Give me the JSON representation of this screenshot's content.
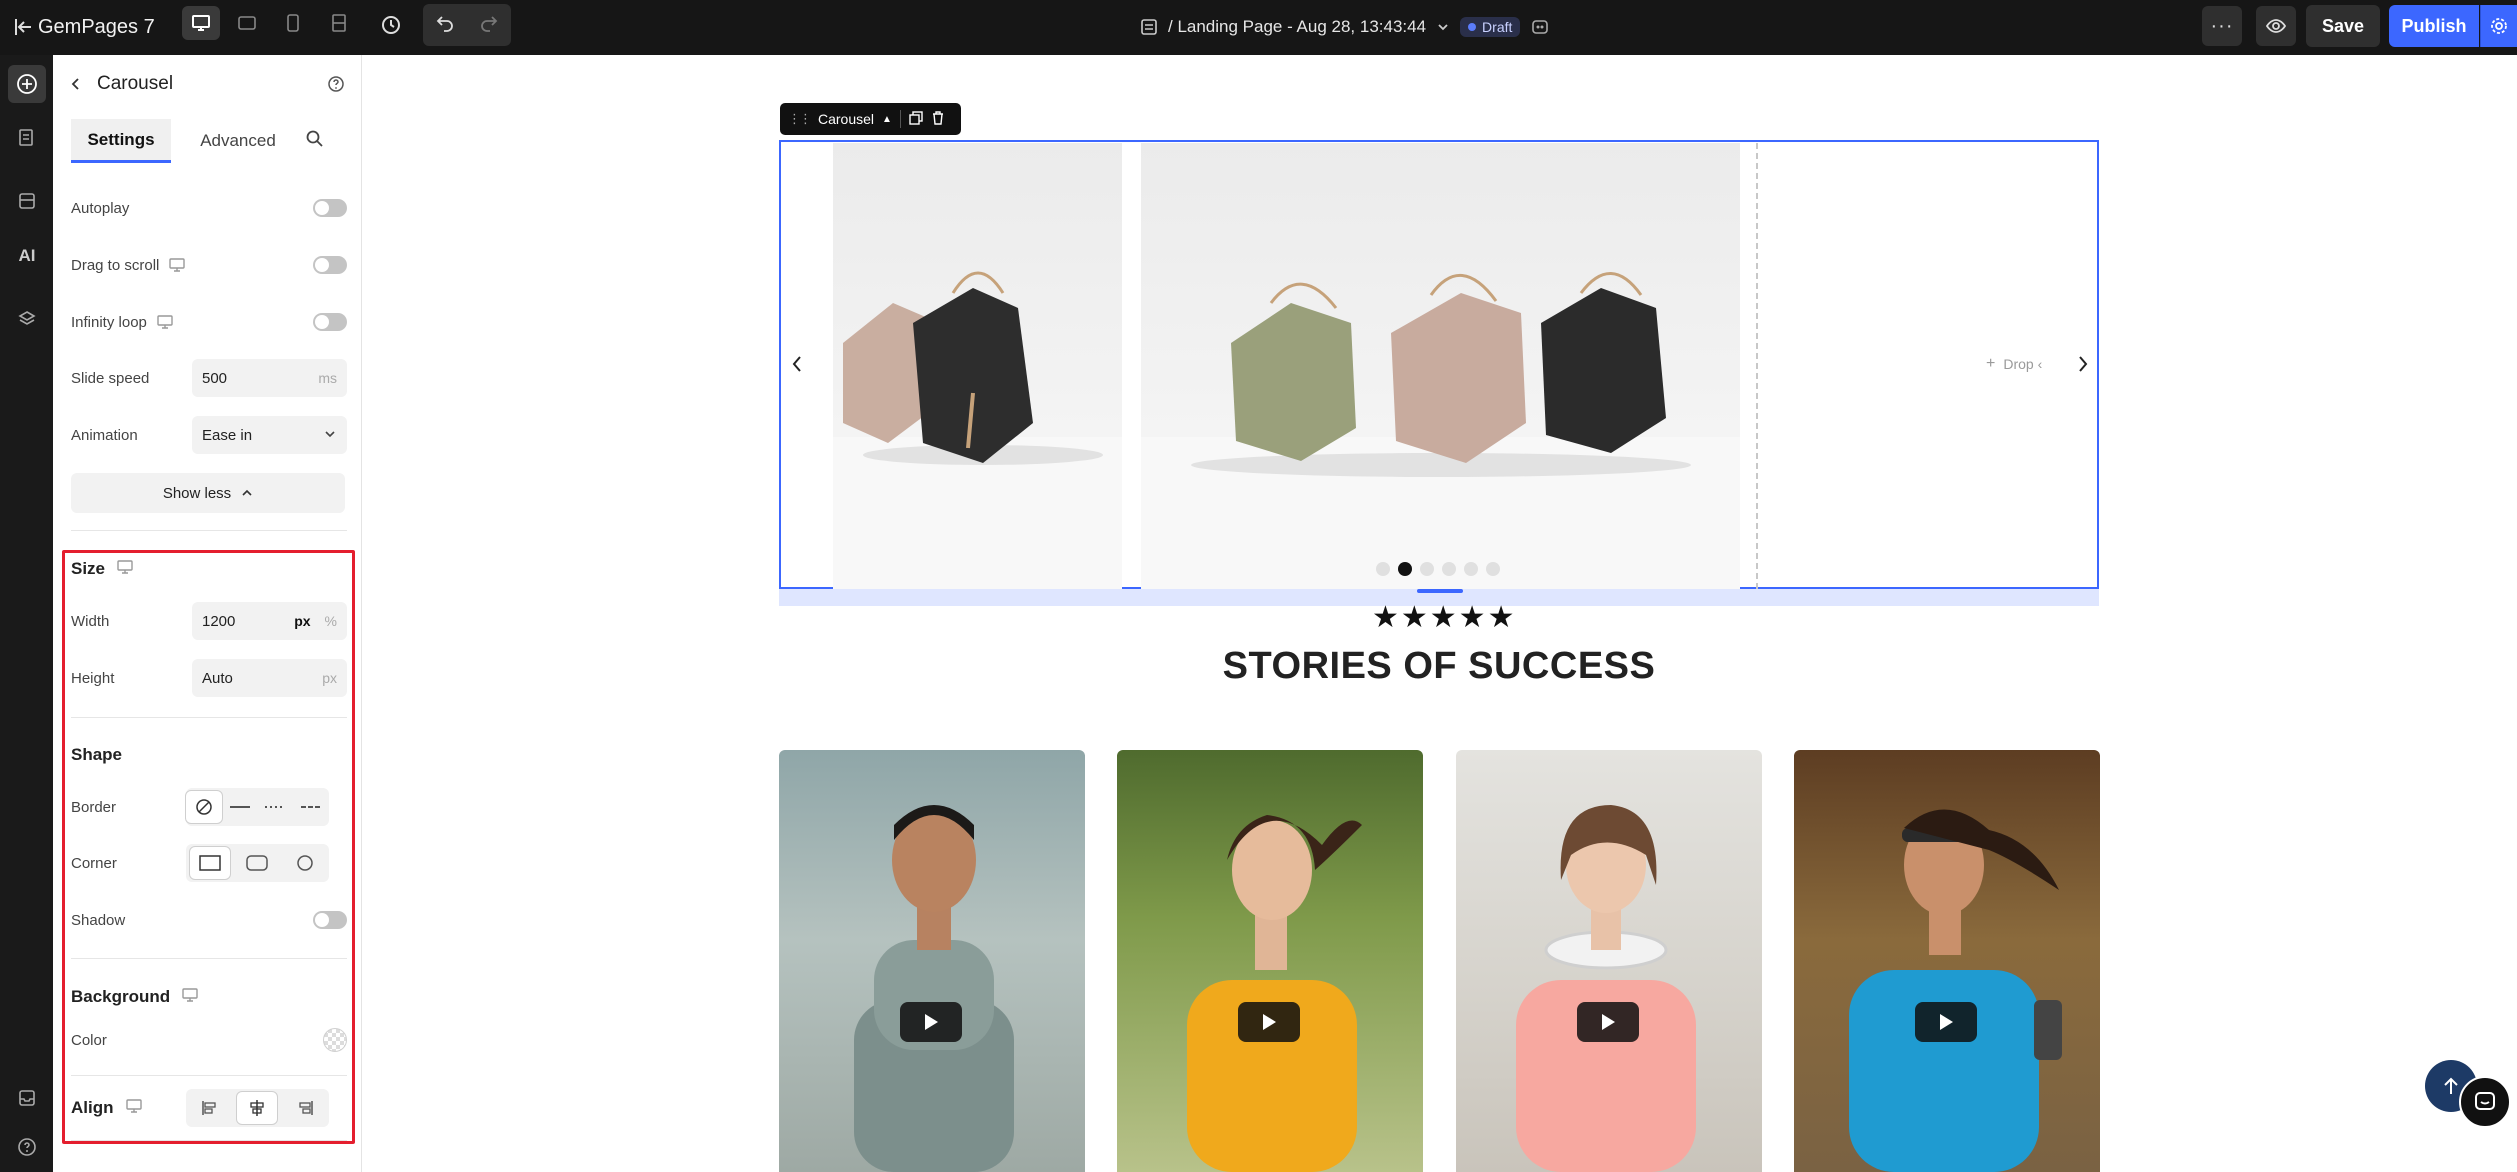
{
  "app": {
    "brand": "GemPages 7",
    "page_title": "/ Landing Page - Aug 28, 13:43:44",
    "status_badge": "Draft",
    "save_label": "Save",
    "publish_label": "Publish"
  },
  "panel": {
    "title": "Carousel",
    "tabs": [
      "Settings",
      "Advanced"
    ],
    "autoplay_label": "Autoplay",
    "drag_label": "Drag to scroll",
    "infinity_label": "Infinity loop",
    "slide_speed_label": "Slide speed",
    "slide_speed_value": "500",
    "slide_speed_unit": "ms",
    "animation_label": "Animation",
    "animation_value": "Ease in",
    "show_less_label": "Show less",
    "size": {
      "title": "Size",
      "width_label": "Width",
      "width_value": "1200",
      "width_unit_px": "px",
      "width_unit_pct": "%",
      "height_label": "Height",
      "height_value": "Auto",
      "height_unit": "px"
    },
    "shape": {
      "title": "Shape",
      "border_label": "Border",
      "corner_label": "Corner",
      "shadow_label": "Shadow"
    },
    "background": {
      "title": "Background",
      "color_label": "Color"
    },
    "align": {
      "title": "Align"
    }
  },
  "canvas": {
    "carousel_tag": "Carousel",
    "drop_text": "Drop ‹",
    "dots_count": 6,
    "active_dot": 1,
    "stars": "★★★★★",
    "section_title": "STORIES OF SUCCESS"
  },
  "colors": {
    "accent": "#3c67ff",
    "highlight": "#e41e2e",
    "topbar": "#161616"
  }
}
